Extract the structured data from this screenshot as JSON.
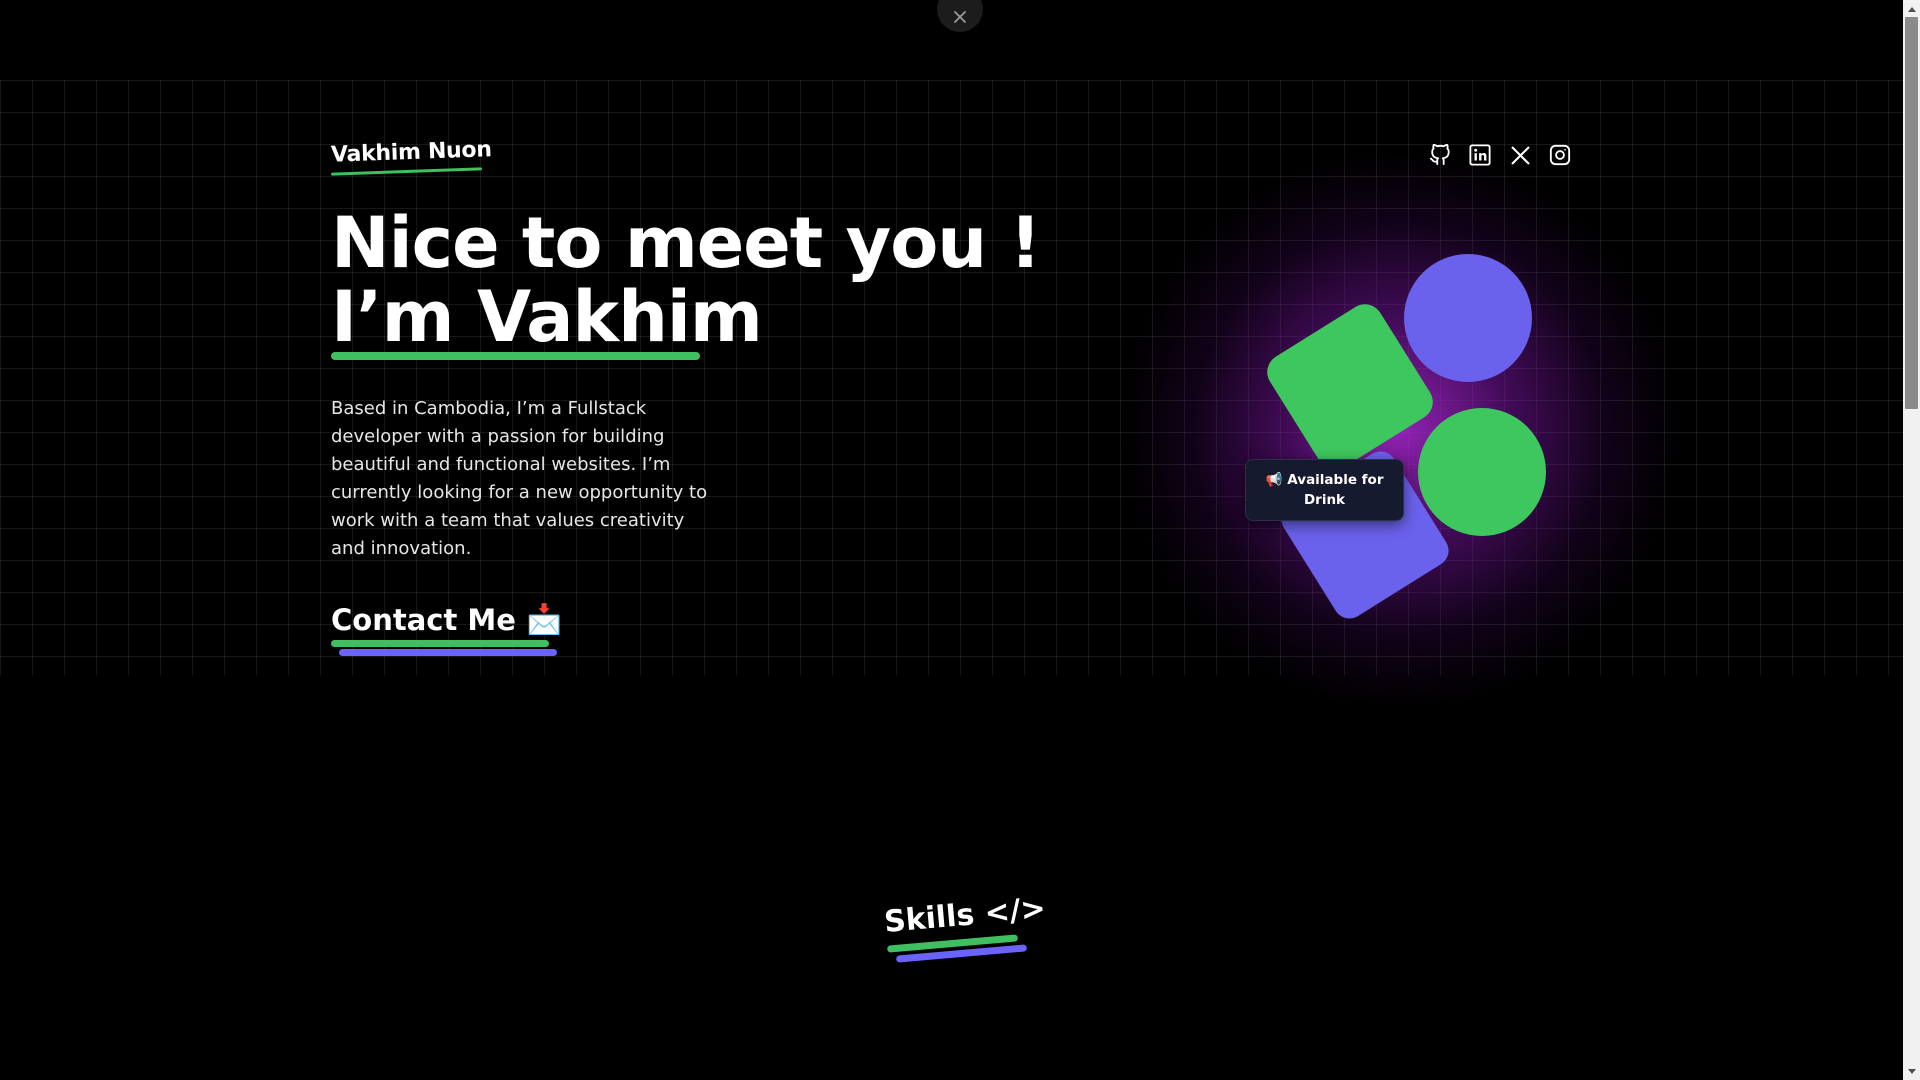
{
  "header": {
    "brand": "Vakhim Nuon",
    "social_links": [
      {
        "icon": "github-icon"
      },
      {
        "icon": "linkedin-icon"
      },
      {
        "icon": "x-icon"
      },
      {
        "icon": "instagram-icon"
      }
    ]
  },
  "hero": {
    "headline_line1": "Nice to meet you !",
    "headline_line2": "I’m Vakhim",
    "bio": "Based in Cambodia, I’m a Fullstack developer with a passion for building beautiful and functional websites. I’m currently looking for a new opportunity to work with a team that values creativity and innovation.",
    "contact_label": "Contact Me",
    "contact_icon": "📩",
    "badge_icon": "📢",
    "badge_line1": "Available for",
    "badge_line2": "Drink"
  },
  "skills": {
    "title": "Skills </>"
  },
  "colors": {
    "accent_green": "#3fc75f",
    "accent_purple": "#6a62ec",
    "glow": "#aa28d2",
    "background": "#000000"
  }
}
